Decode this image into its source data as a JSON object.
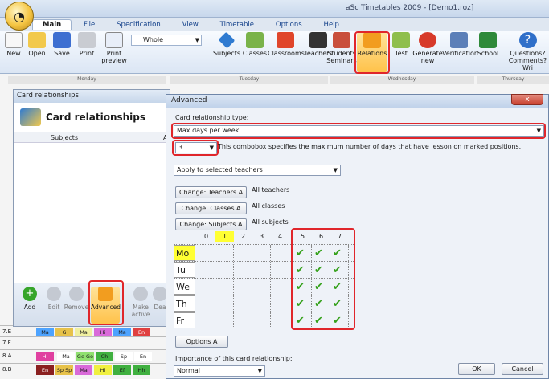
{
  "app": {
    "title": "aSc Timetables 2009 - [Demo1.roz]"
  },
  "ribbon": {
    "tabs": [
      "Main",
      "File",
      "Specification",
      "View",
      "Timetable",
      "Options",
      "Help"
    ],
    "buttons": {
      "new": "New",
      "open": "Open",
      "save": "Save",
      "print": "Print",
      "print_preview": "Print preview",
      "subjects": "Subjects",
      "classes": "Classes",
      "classrooms": "Classrooms",
      "teachers": "Teachers",
      "students_seminars": "Students Seminars",
      "relations": "Relations",
      "test": "Test",
      "generate_new": "Generate new",
      "verification": "Verification",
      "school": "School",
      "questions": "Questions? Comments? Wri"
    },
    "view_select": "Whole"
  },
  "timetable": {
    "days": [
      "Monday",
      "Tuesday",
      "Wednesday",
      "Thursday"
    ],
    "rows": [
      {
        "label": "7.E",
        "cells": [
          "Ma",
          "G",
          "Ma",
          "Hi",
          "Ma",
          "En"
        ]
      },
      {
        "label": "7.F",
        "cells": []
      },
      {
        "label": "8.A",
        "cells": [
          "Hi",
          "Ma",
          "Ge Ge",
          "Ch",
          "Sp",
          "En"
        ]
      },
      {
        "label": "8.B",
        "cells": [
          "En",
          "Sp Sp",
          "Ma",
          "Hi",
          "Ef",
          "Hh"
        ]
      }
    ]
  },
  "card_window": {
    "title": "Card relationships",
    "heading": "Card relationships",
    "columns": [
      "Subjects",
      "Ap"
    ],
    "buttons": {
      "add": "Add",
      "edit": "Edit",
      "remove": "Remove",
      "advanced": "Advanced",
      "make_active": "Make active",
      "dead": "Dea"
    }
  },
  "advanced": {
    "title": "Advanced",
    "type_label": "Card relationship type:",
    "type_value": "Max days per week",
    "count_value": "3",
    "count_help": "This combobox specifies the maximum number of days that have lesson on marked positions.",
    "apply_value": "Apply to selected teachers",
    "change_teachers": "Change: Teachers A",
    "teachers_desc": "All teachers",
    "change_classes": "Change: Classes A",
    "classes_desc": "All classes",
    "change_subjects": "Change: Subjects A",
    "subjects_desc": "All subjects",
    "periods": [
      "0",
      "1",
      "2",
      "3",
      "4",
      "5",
      "6",
      "7"
    ],
    "days": [
      "Mo",
      "Tu",
      "We",
      "Th",
      "Fr"
    ],
    "checked_periods": [
      "5",
      "6",
      "7"
    ],
    "options_button": "Options A",
    "importance_label": "Importance of this card relationship:",
    "importance_value": "Normal",
    "ok": "OK",
    "cancel": "Cancel",
    "close": "x"
  },
  "colors": {
    "accent_red": "#e0262b",
    "check_green": "#35a11b",
    "highlight_yellow": "#ffff33"
  }
}
